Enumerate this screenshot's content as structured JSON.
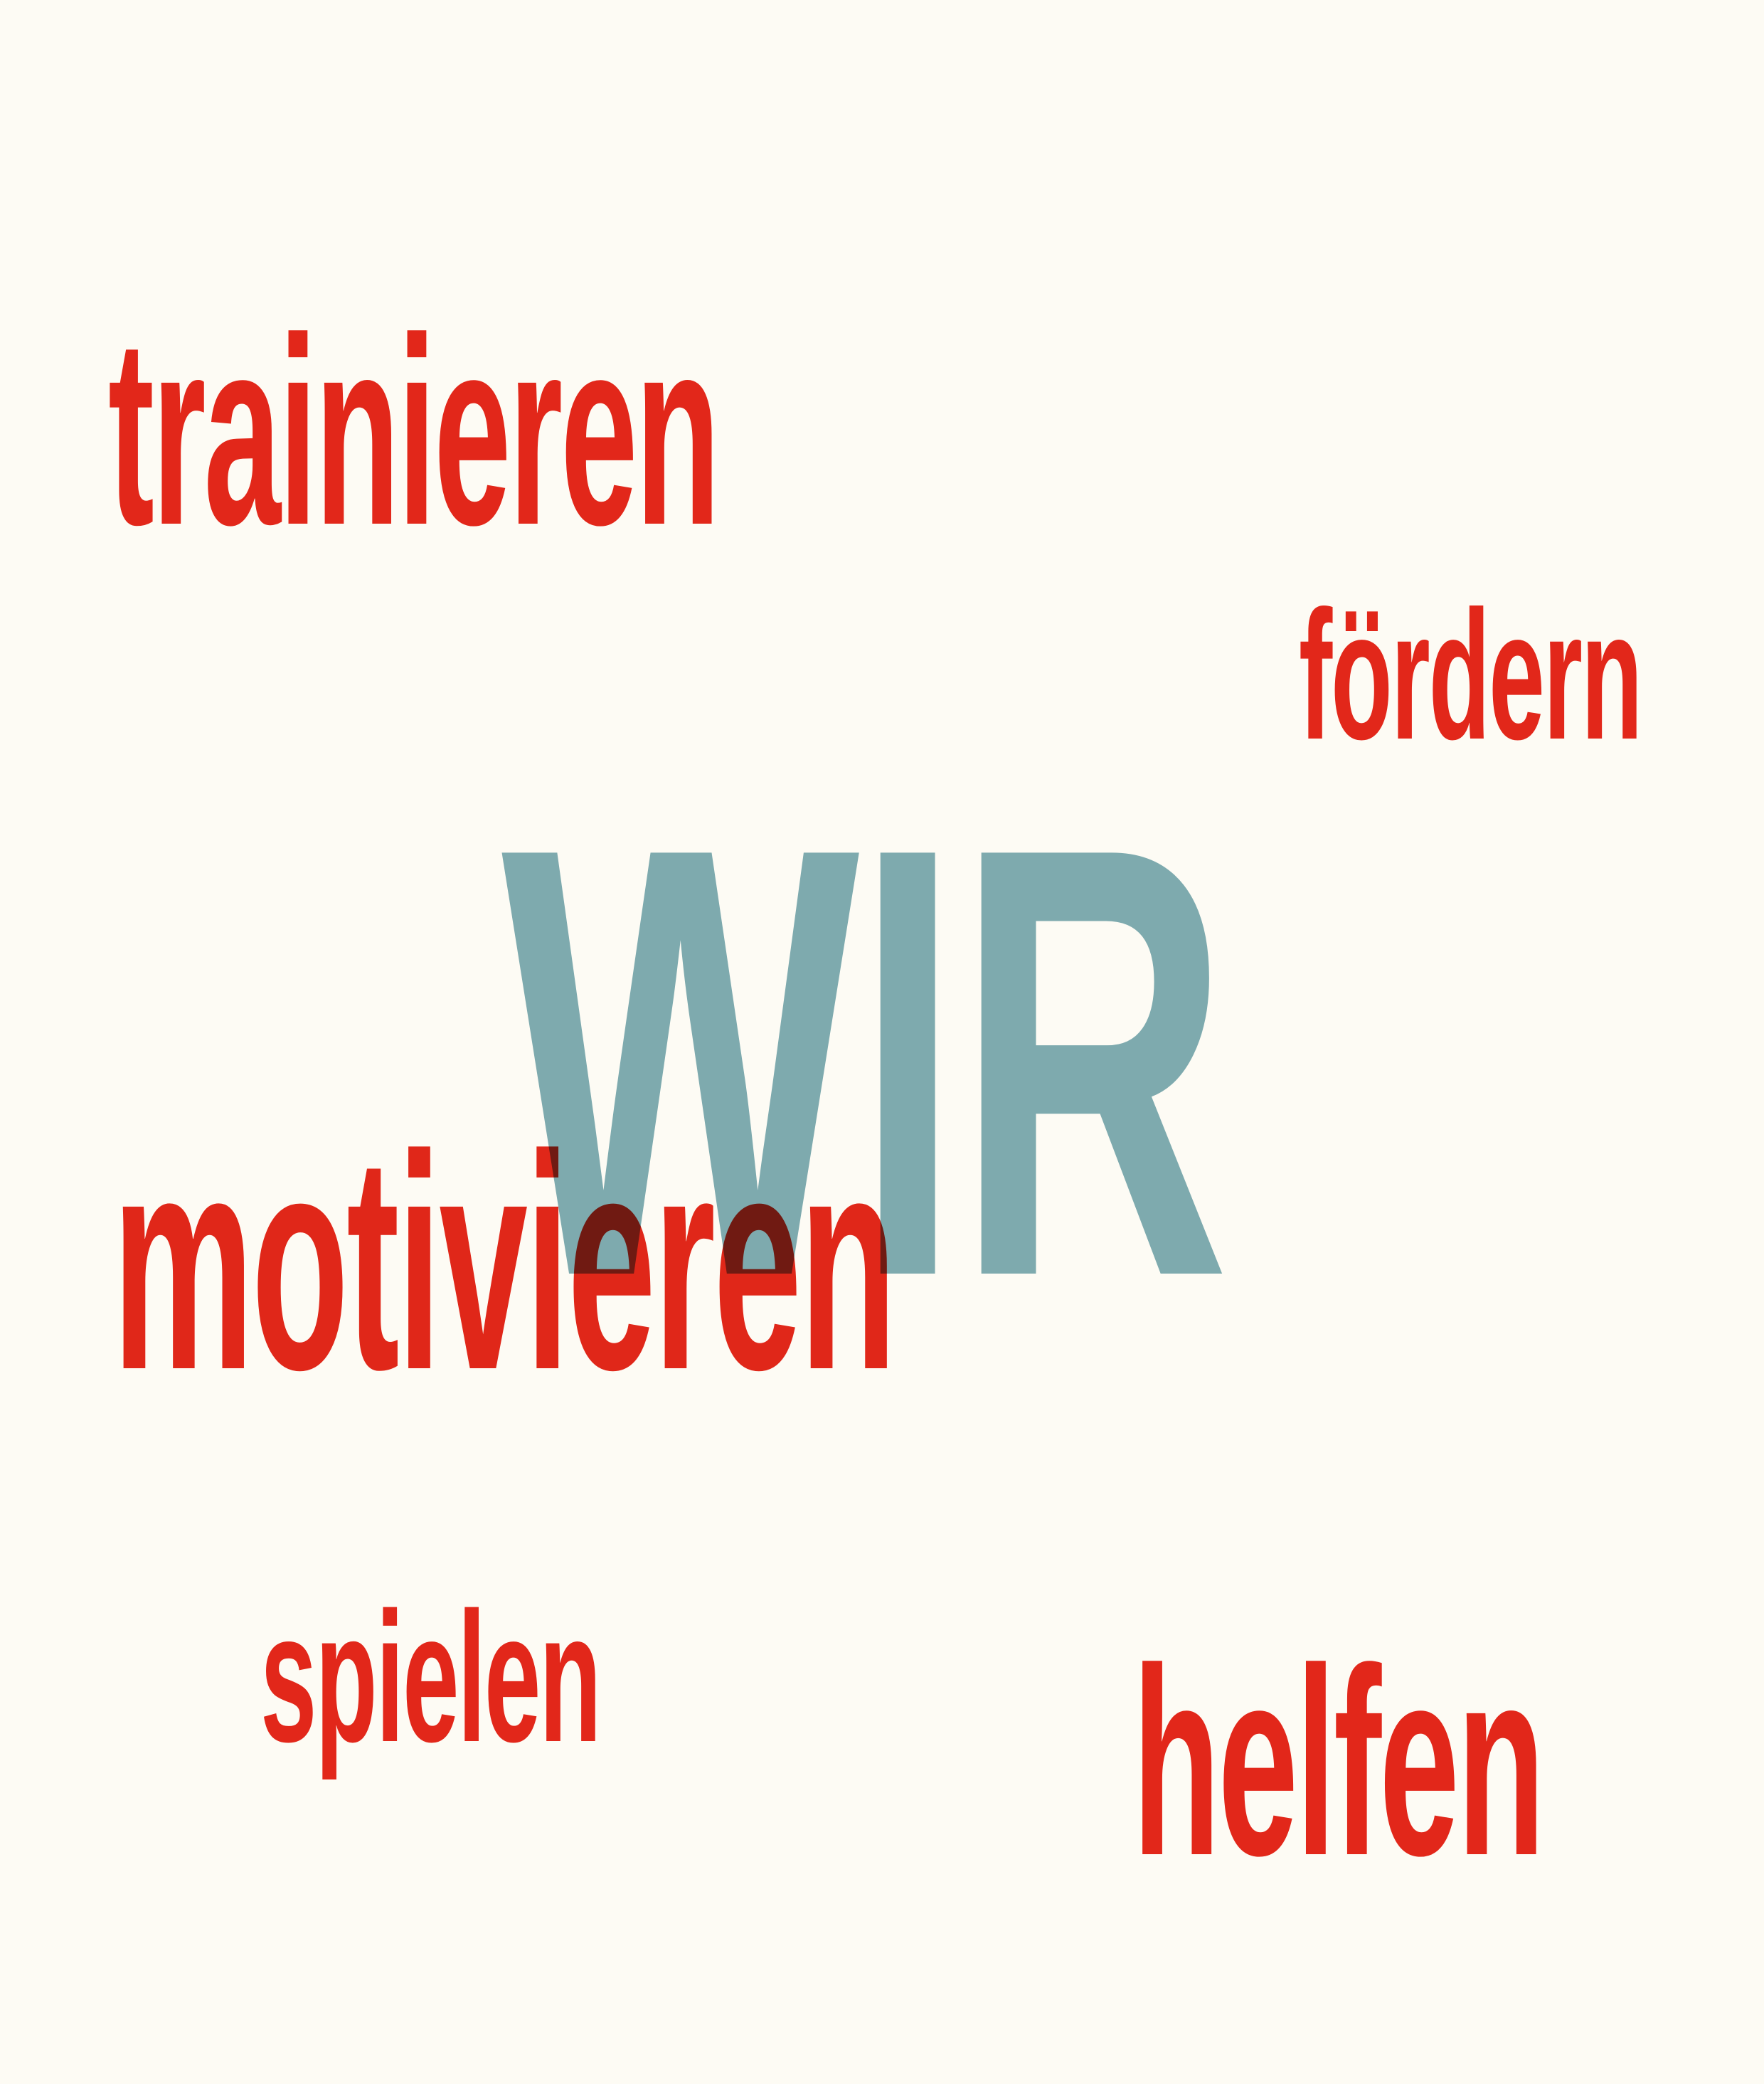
{
  "colors": {
    "background": "#fdfbf4",
    "accent_red": "#e2271a",
    "muted_teal": "#7eaaae"
  },
  "words": {
    "wir": "WIR",
    "trainieren": "trainieren",
    "foerdern": "fördern",
    "motivieren": "motivieren",
    "spielen": "spielen",
    "helfen": "helfen"
  }
}
